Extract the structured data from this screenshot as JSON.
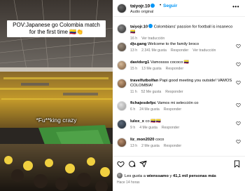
{
  "video": {
    "caption": "POV:Japanese go Colombia match for the first time 🇨🇴👏",
    "overlay_text": "*Fu**king crazy"
  },
  "post": {
    "author": "taiyojr.10",
    "follow_label": "Seguir",
    "dot": "•",
    "audio_label": "Audio original",
    "more_icon": "more-horizontal-icon",
    "post_caption": {
      "user": "taiyojr.10",
      "text": "Colombians' passion for football is insaneco 🇨🇴",
      "time": "16 h",
      "translate": "Ver traducción"
    },
    "comments": [
      {
        "user": "djv.gang",
        "text": "Welcome to the family broco",
        "time": "13 h",
        "likes": "2.341 Me gusta",
        "reply": "Responder",
        "extra": "Ver traducción"
      },
      {
        "user": "davidsrg1",
        "text": "Vamossss cococo 🇨🇴",
        "time": "15 h",
        "likes": "13 Me gusta",
        "reply": "Responder",
        "extra": ""
      },
      {
        "user": "travelfutbolfan",
        "text": "Papi good meeting you outside! VAMOS COLOMBIA!",
        "time": "11 h",
        "likes": "52 Me gusta",
        "reply": "Responder",
        "extra": ""
      },
      {
        "user": "fichajesdefpc",
        "text": "Vamos mi selección co",
        "time": "6 h",
        "likes": "24 Me gusta",
        "reply": "Responder",
        "extra": ""
      },
      {
        "user": "lulox_x",
        "text": "co 🇨🇴🇨🇴",
        "time": "9 h",
        "likes": "4 Me gusta",
        "reply": "Responder",
        "extra": ""
      },
      {
        "user": "liz_mon2020",
        "text": "coco",
        "time": "13 h",
        "likes": "2 Me gusta",
        "reply": "Responder",
        "extra": ""
      }
    ],
    "likes_text_prefix": "Les gusta a",
    "likes_user": "wienssamo",
    "likes_text_middle": "y",
    "likes_count": "41,1 mil personas más",
    "time": "Hace 14 horas"
  },
  "icons": {
    "heart": "heart-icon",
    "comment": "comment-icon",
    "share": "share-icon",
    "bookmark": "bookmark-icon",
    "verified": "verified-badge-icon"
  },
  "colors": {
    "accent": "#0095f6",
    "muted": "#737373"
  }
}
